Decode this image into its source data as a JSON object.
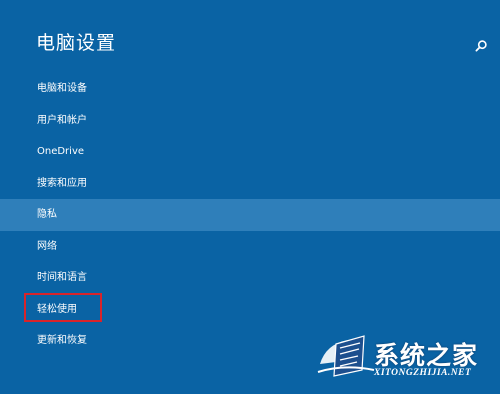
{
  "window": {
    "title": "电脑设置"
  },
  "search": {
    "icon": "search-icon"
  },
  "nav": {
    "items": [
      {
        "label": "电脑和设备"
      },
      {
        "label": "用户和帐户"
      },
      {
        "label": "OneDrive"
      },
      {
        "label": "搜索和应用"
      },
      {
        "label": "隐私",
        "selected": true
      },
      {
        "label": "网络"
      },
      {
        "label": "时间和语言"
      },
      {
        "label": "轻松使用",
        "highlighted": true
      },
      {
        "label": "更新和恢复"
      }
    ]
  },
  "watermark": {
    "brand_cn": "系统之家",
    "brand_en": "XITONGZHIJIA.NET"
  },
  "colors": {
    "background": "#0a63a4",
    "selected_row": "#2f7fba",
    "highlight_border": "#d9242b",
    "text": "#ffffff"
  }
}
